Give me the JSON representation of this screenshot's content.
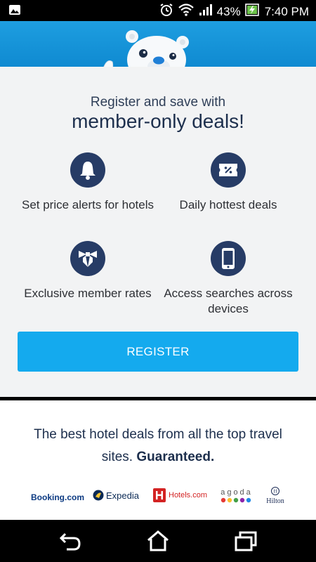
{
  "status_bar": {
    "battery_percent": "43%",
    "time": "7:40 PM",
    "icons": [
      "image-icon",
      "alarm-icon",
      "wifi-icon",
      "signal-icon",
      "battery-charging-icon"
    ]
  },
  "promo": {
    "subtitle": "Register and save with",
    "headline": "member-only deals!",
    "features": [
      {
        "icon": "bell-icon",
        "label": "Set price alerts for hotels"
      },
      {
        "icon": "ticket-icon",
        "label": "Daily hottest deals"
      },
      {
        "icon": "bowtie-icon",
        "label": "Exclusive member rates"
      },
      {
        "icon": "smartphone-icon",
        "label": "Access searches across devices"
      }
    ],
    "register_label": "REGISTER"
  },
  "partners": {
    "tagline_part1": "The best hotel deals from all the top travel sites.",
    "tagline_bold": "Guaranteed.",
    "logos": {
      "booking": "Booking.com",
      "expedia": "Expedia",
      "hotels": "Hotels.com",
      "agoda": "agoda",
      "hilton": "Hilton"
    }
  },
  "nav": {
    "buttons": [
      "back-icon",
      "home-icon",
      "recent-apps-icon"
    ]
  },
  "colors": {
    "hero_blue": "#1e9ee0",
    "navy": "#273c66",
    "register_blue": "#14aaee",
    "card_bg": "#f2f3f4"
  }
}
